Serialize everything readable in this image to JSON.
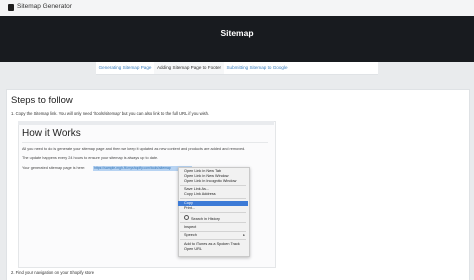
{
  "app": {
    "title": "Sitemap Generator"
  },
  "hero": {
    "title": "Sitemap"
  },
  "tabs": [
    {
      "label": "Generating Sitemap Page"
    },
    {
      "label": "Adding Sitemap Page to Footer"
    },
    {
      "label": "Submitting Sitemap to Google"
    }
  ],
  "main": {
    "heading": "Steps to follow",
    "step1": "1. Copy the Sitemap link. You will only need '/tools/sitemap' but you can also link to the full URL if you wish.",
    "step2": "2. Find your navigation on your Shopify store"
  },
  "screenshot": {
    "heading": "How it Works",
    "paragraph1": "All you need to do is generate your sitemap page and then we keep it updated as new content and products are added and removed.",
    "paragraph2": "The update happens every 24 hours to ensure your sitemap is always up to date.",
    "link_label": "Your generated sitemap page is here:",
    "link_url": "https://sample-mgh-fit.myshopify.com/tools/sitemap"
  },
  "context_menu": {
    "items": [
      "Open Link in New Tab",
      "Open Link in New Window",
      "Open Link in Incognito Window",
      "Save Link As...",
      "Copy Link Address",
      "Copy",
      "Print...",
      "Search in History",
      "Inspect",
      "Speech",
      "Add to iTunes as a Spoken Track",
      "Open URL"
    ],
    "highlighted": "Copy",
    "submenu_arrow": "▸",
    "highlight_color": "#3c7ad6"
  },
  "colors": {
    "hero_bg": "#181b1f",
    "link": "#3a7fbf",
    "selection": "#b7d3f2"
  }
}
